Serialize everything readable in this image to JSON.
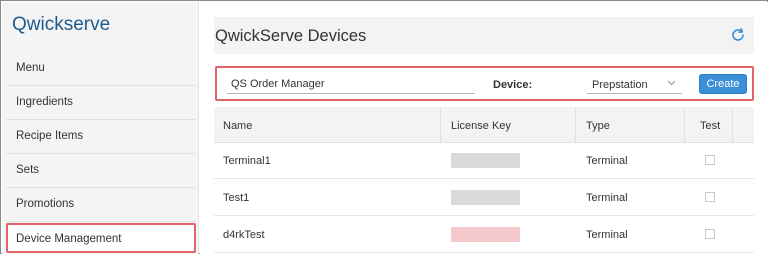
{
  "app": {
    "brand": "Qwickserve"
  },
  "sidebar": {
    "items": [
      {
        "label": "Menu"
      },
      {
        "label": "Ingredients"
      },
      {
        "label": "Recipe Items"
      },
      {
        "label": "Sets"
      },
      {
        "label": "Promotions"
      },
      {
        "label": "Device Management",
        "active": true
      }
    ]
  },
  "header": {
    "title": "QwickServe Devices",
    "refresh_icon": "refresh-icon"
  },
  "filter": {
    "order_manager_value": "QS Order Manager",
    "device_label": "Device:",
    "device_selected": "Prepstation",
    "create_label": "Create"
  },
  "table": {
    "columns": [
      "Name",
      "License Key",
      "Type",
      "Test"
    ],
    "rows": [
      {
        "name": "Terminal1",
        "type": "Terminal",
        "test": false,
        "key_color": "#d9d9d9"
      },
      {
        "name": "Test1",
        "type": "Terminal",
        "test": false,
        "key_color": "#d9d9d9"
      },
      {
        "name": "d4rkTest",
        "type": "Terminal",
        "test": false,
        "key_color": "#f5c9cb"
      }
    ]
  },
  "colors": {
    "accent": "#3a8fd8",
    "brand": "#1f5a8c",
    "highlight": "#e06469"
  }
}
